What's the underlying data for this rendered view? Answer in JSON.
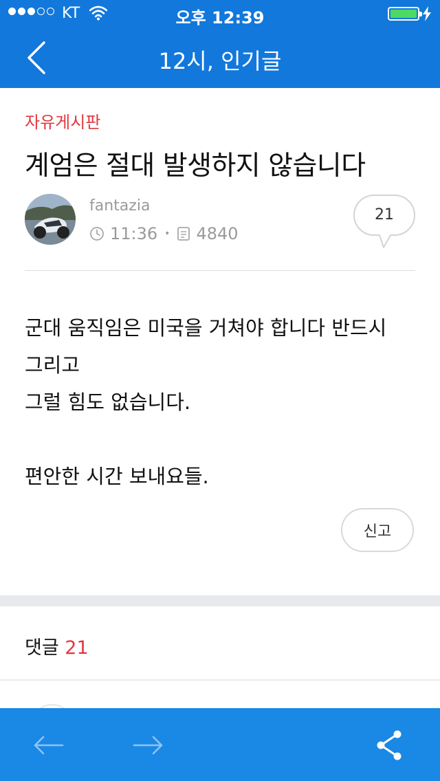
{
  "status_bar": {
    "carrier": "KT",
    "time": "오후 12:39",
    "signal_bars_full": 3,
    "signal_bars_total": 5,
    "battery_level": 1.0
  },
  "nav": {
    "back_icon": "chevron-left-icon",
    "title": "12시, 인기글"
  },
  "post": {
    "board": "자유게시판",
    "title": "계엄은 절대 발생하지 않습니다",
    "author": "fantazia",
    "time": "11:36",
    "views": "4840",
    "comment_count": "21",
    "body": [
      "군대 움직임은 미국을 거쳐야 합니다 반드시",
      "그리고",
      "그럴 힘도 없습니다.",
      "",
      "편안한 시간 보내요들."
    ],
    "report_label": "신고"
  },
  "comments": {
    "label": "댓글",
    "count": "21"
  },
  "toolbar": {
    "prev_icon": "arrow-left-icon",
    "next_icon": "arrow-right-icon",
    "share_icon": "share-icon"
  },
  "colors": {
    "header_blue": "#1278db",
    "toolbar_blue": "#1a88e5",
    "accent_red": "#e0383e",
    "battery_green": "#4cd964"
  }
}
